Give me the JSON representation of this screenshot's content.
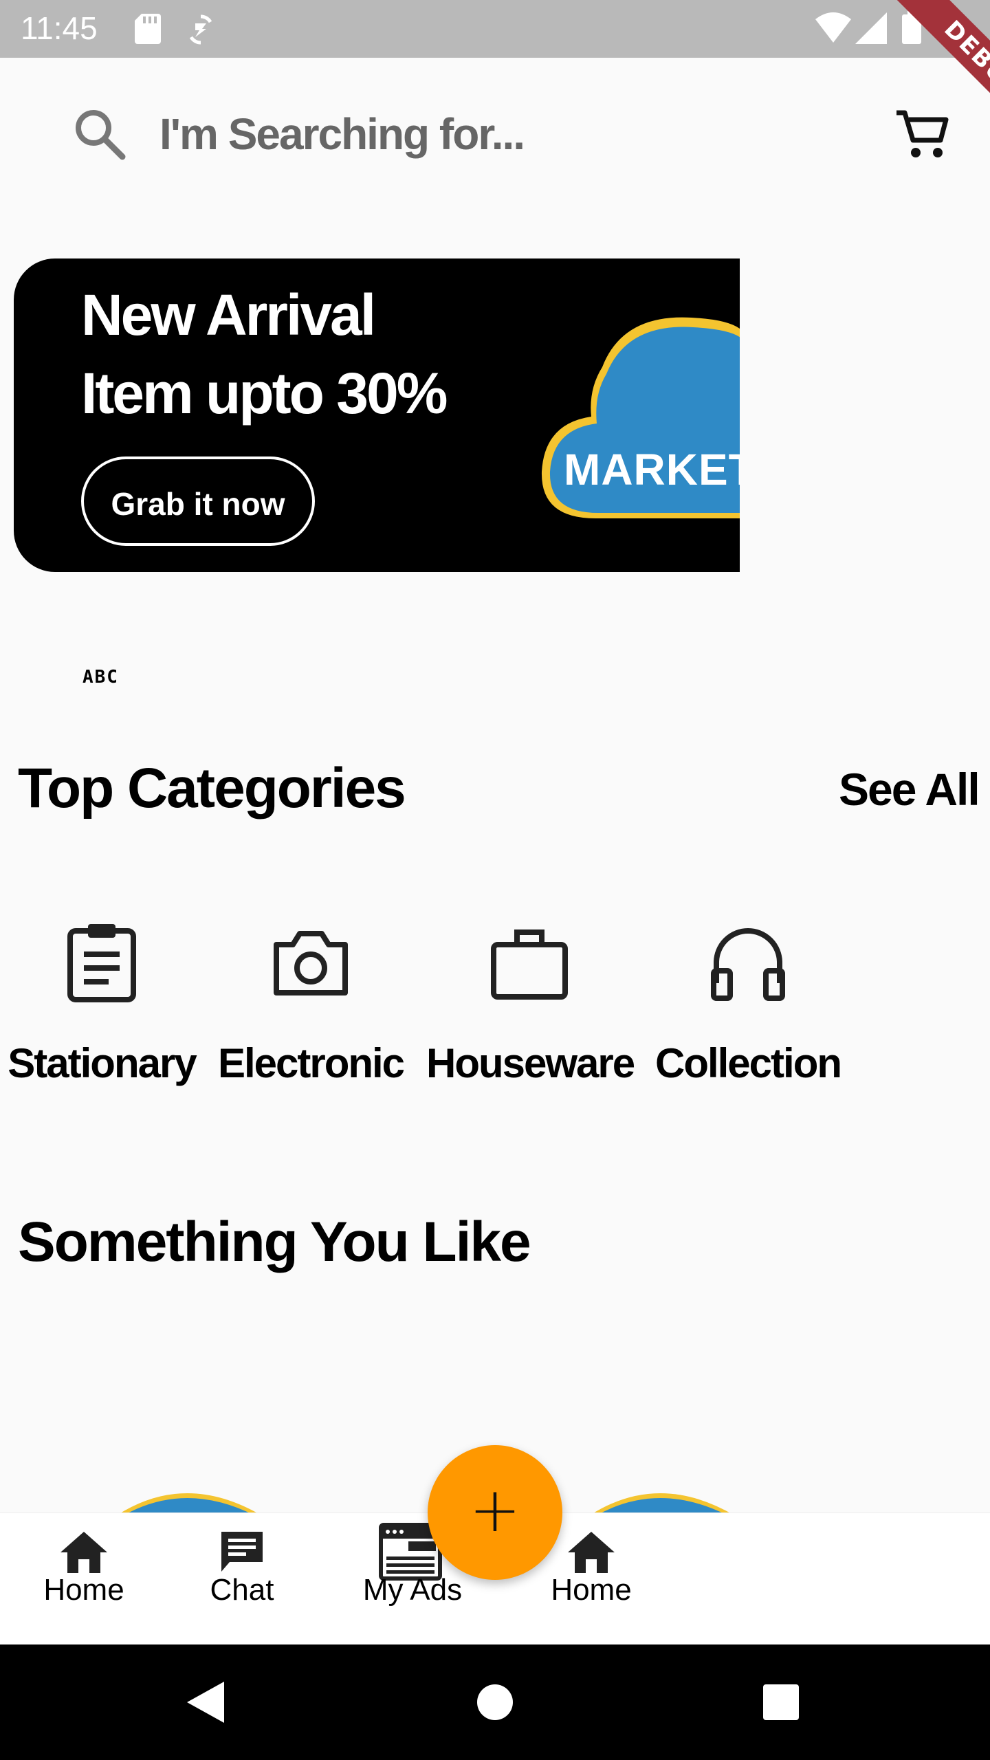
{
  "status_bar": {
    "time": "11:45",
    "debug_label": "DEBUG",
    "icons": [
      "sd-card-icon",
      "sync-icon",
      "wifi-icon",
      "signal-icon",
      "battery-icon"
    ]
  },
  "search": {
    "placeholder": "I'm Searching for...",
    "icon": "search-icon"
  },
  "cart": {
    "icon": "cart-icon"
  },
  "promo": {
    "line1": "New Arrival",
    "line2": "Item upto 30%",
    "button": "Grab it now",
    "image_text": "MARKET",
    "colors": {
      "background": "#000000",
      "cloud": "#2f8ac6",
      "cloud_rim": "#f4c430"
    }
  },
  "abc_label": "ABC",
  "categories": {
    "title": "Top Categories",
    "see_all": "See All",
    "items": [
      {
        "label": "Stationary",
        "icon": "clipboard-icon"
      },
      {
        "label": "Electronic",
        "icon": "camera-icon"
      },
      {
        "label": "Houseware",
        "icon": "briefcase-icon"
      },
      {
        "label": "Collection",
        "icon": "headphones-icon"
      }
    ]
  },
  "something_you_like": {
    "title": "Something You Like"
  },
  "bottom_nav": {
    "items": [
      {
        "label": "Home",
        "icon": "home-icon"
      },
      {
        "label": "Chat",
        "icon": "chat-icon"
      },
      {
        "label": "My Ads",
        "icon": "ads-icon"
      },
      {
        "label": "Home",
        "icon": "home-icon"
      }
    ],
    "fab": {
      "symbol": "+",
      "icon": "add-icon",
      "color": "#ff9800"
    }
  },
  "system_nav": {
    "icons": [
      "back-icon",
      "home-circle-icon",
      "recents-icon"
    ]
  }
}
